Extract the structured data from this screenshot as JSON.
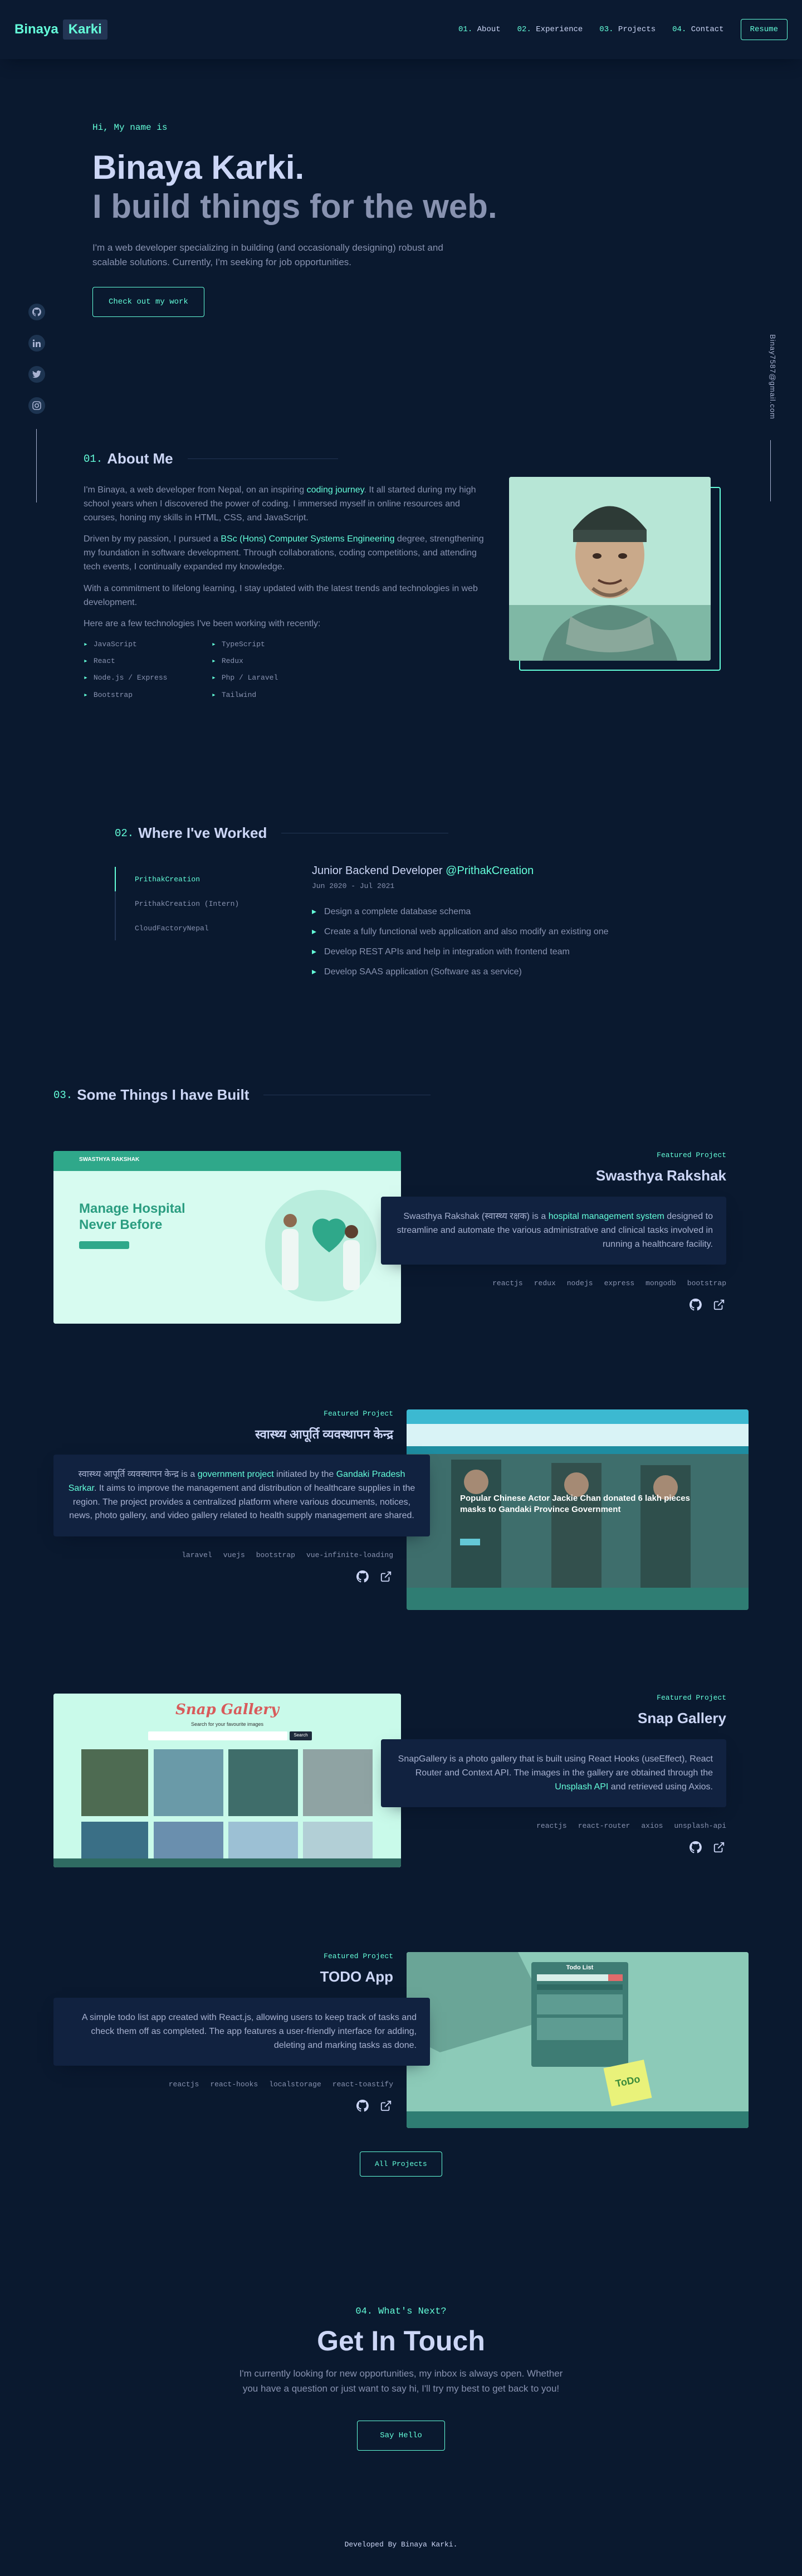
{
  "nav": {
    "logo_first": "Binaya",
    "logo_second": "Karki",
    "links": [
      {
        "num": "01.",
        "label": "About"
      },
      {
        "num": "02.",
        "label": "Experience"
      },
      {
        "num": "03.",
        "label": "Projects"
      },
      {
        "num": "04.",
        "label": "Contact"
      }
    ],
    "resume": "Resume"
  },
  "socials": [
    "github-icon",
    "linkedin-icon",
    "twitter-icon",
    "instagram-icon"
  ],
  "email": "Binay7587@gmail.com",
  "hero": {
    "hi": "Hi, My name is",
    "name": "Binaya Karki.",
    "tagline": "I build things for the web.",
    "desc": "I'm a web developer specializing in building (and occasionally designing) robust and scalable solutions. Currently, I'm seeking for job opportunities.",
    "cta": "Check out my work"
  },
  "about": {
    "num": "01.",
    "heading": "About Me",
    "p1_a": "I'm Binaya, a web developer from Nepal, on an inspiring ",
    "p1_b": "coding journey",
    "p1_c": ". It all started during my high school years when I discovered the power of coding. I immersed myself in online resources and courses, honing my skills in HTML, CSS, and JavaScript.",
    "p2_a": "Driven by my passion, I pursued a ",
    "p2_b": "BSc (Hons) Computer Systems Engineering",
    "p2_c": " degree, strengthening my foundation in software development. Through collaborations, coding competitions, and attending tech events, I continually expanded my knowledge.",
    "p3": "With a commitment to lifelong learning, I stay updated with the latest trends and technologies in web development.",
    "p4": "Here are a few technologies I've been working with recently:",
    "tech": [
      "JavaScript",
      "TypeScript",
      "React",
      "Redux",
      "Node.js / Express",
      "Php / Laravel",
      "Bootstrap",
      "Tailwind"
    ]
  },
  "work": {
    "num": "02.",
    "heading": "Where I've Worked",
    "tabs": [
      "PrithakCreation",
      "PrithakCreation (Intern)",
      "CloudFactoryNepal"
    ],
    "job_title": "Junior Backend Developer ",
    "job_company": "@PrithakCreation",
    "job_date": "Jun 2020 - Jul 2021",
    "duties": [
      "Design a complete database schema",
      "Create a fully functional web application and also modify an existing one",
      "Develop REST APIs and help in integration with frontend team",
      "Develop SAAS application (Software as a service)"
    ]
  },
  "projects": {
    "num": "03.",
    "heading": "Some Things I have Built",
    "featured_label": "Featured Project",
    "items": [
      {
        "title": "Swasthya Rakshak",
        "desc_a": "Swasthya Rakshak (स्वास्थ्य रक्षक) is a ",
        "desc_link": "hospital management system",
        "desc_b": " designed to streamline and automate the various administrative and clinical tasks involved in running a healthcare facility.",
        "tech": [
          "reactjs",
          "redux",
          "nodejs",
          "express",
          "mongodb",
          "bootstrap"
        ],
        "img_heading": "Manage Hospital Never Before",
        "img_nav": "SWASTHYA RAKSHAK"
      },
      {
        "title": "स्वास्थ्य आपूर्ति व्यवस्थापन केन्द्र",
        "desc_a": "स्वास्थ्य आपूर्ति व्यवस्थापन केन्द्र is a ",
        "desc_link": "government project",
        "desc_b": " initiated by the ",
        "desc_link2": "Gandaki Pradesh Sarkar",
        "desc_c": ". It aims to improve the management and distribution of healthcare supplies in the region. The project provides a centralized platform where various documents, notices, news, photo gallery, and video gallery related to health supply management are shared.",
        "tech": [
          "laravel",
          "vuejs",
          "bootstrap",
          "vue-infinite-loading"
        ],
        "img_heading": "Popular Chinese Actor Jackie Chan donated 6 lakh pieces masks to Gandaki Province Government"
      },
      {
        "title": "Snap Gallery",
        "desc_a": "SnapGallery is a photo gallery that is built using React Hooks (useEffect), React Router and Context API. The images in the gallery are obtained through the ",
        "desc_link": "Unsplash API",
        "desc_b": " and retrieved using Axios.",
        "tech": [
          "reactjs",
          "react-router",
          "axios",
          "unsplash-api"
        ],
        "img_heading": "Snap Gallery",
        "img_sub": "Search for your favourite images",
        "img_search": "Search"
      },
      {
        "title": "TODO App",
        "desc_a": "A simple todo list app created with React.js, allowing users to keep track of tasks and check them off as completed. The app features a user-friendly interface for adding, deleting and marking tasks as done.",
        "tech": [
          "reactjs",
          "react-hooks",
          "localstorage",
          "react-toastify"
        ],
        "img_heading": "Todo List",
        "img_note": "ToDo"
      }
    ],
    "all_button": "All Projects"
  },
  "contact": {
    "pre": "04. What's Next?",
    "title": "Get In Touch",
    "desc": "I'm currently looking for new opportunities, my inbox is always open. Whether you have a question or just want to say hi, I'll try my best to get back to you!",
    "button": "Say Hello"
  },
  "footer": "Developed By Binaya Karki.",
  "colors": {
    "accent": "#64ffda",
    "bg": "#0a192f",
    "navy_light": "#112240",
    "text": "#8892b0",
    "heading": "#ccd6f6"
  }
}
